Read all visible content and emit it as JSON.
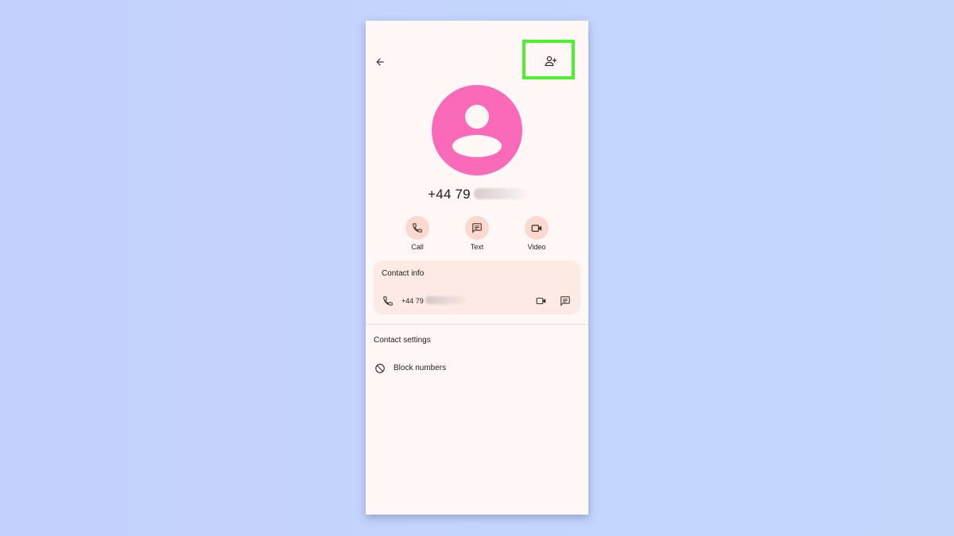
{
  "header": {
    "back_icon": "arrow-left-icon",
    "add_contact_icon": "person-add-icon",
    "highlight_color": "#4cf22e"
  },
  "contact": {
    "avatar_color": "#fb69b9",
    "number_visible": "+44 79"
  },
  "actions": [
    {
      "label": "Call",
      "icon": "phone-icon"
    },
    {
      "label": "Text",
      "icon": "message-icon"
    },
    {
      "label": "Video",
      "icon": "video-icon"
    }
  ],
  "contact_info": {
    "title": "Contact info",
    "number_visible": "+44 79"
  },
  "contact_settings": {
    "title": "Contact settings",
    "block_label": "Block numbers"
  },
  "colors": {
    "background": "#c4d5fd",
    "surface": "#fff8f6",
    "action_circle": "#fbd9ce",
    "card": "#fdeae5"
  }
}
